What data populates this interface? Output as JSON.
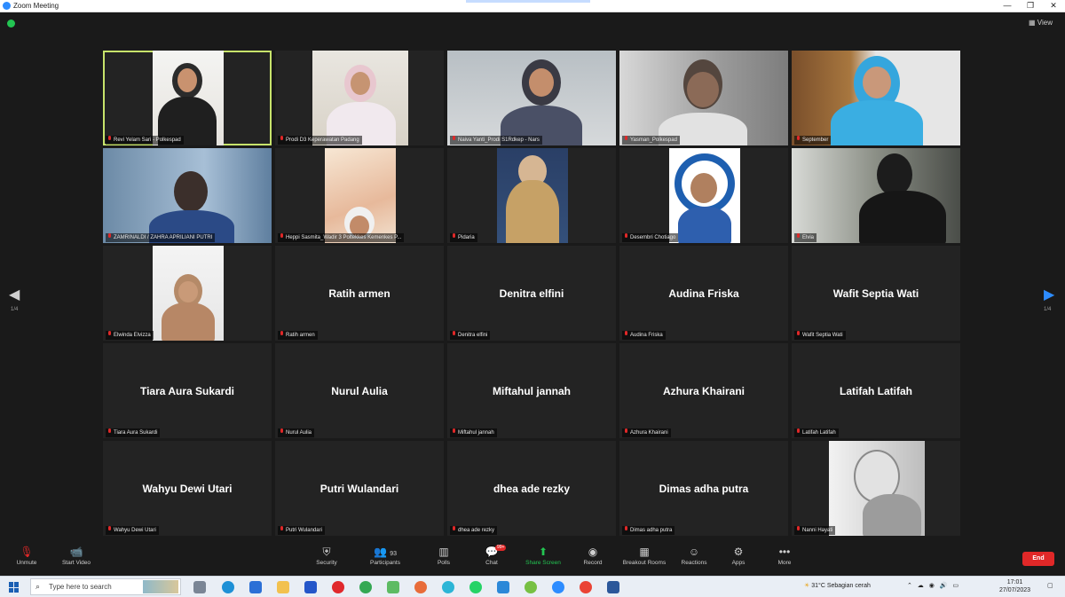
{
  "window": {
    "title": "Zoom Meeting",
    "controls": [
      "—",
      "❐",
      "✕"
    ]
  },
  "top": {
    "view_label": "View"
  },
  "pager": {
    "left": "1/4",
    "right": "1/4"
  },
  "tiles": [
    {
      "label": "Revi Yelam Sari - Polkespad",
      "name": "",
      "video": true
    },
    {
      "label": "Prodi D3 Keperawatan Padang",
      "name": "",
      "video": true
    },
    {
      "label": "Naiva Yanti_Prodi S1Rdkep - Nars",
      "name": "",
      "video": true
    },
    {
      "label": "Yasman_Polkespad",
      "name": "",
      "video": true
    },
    {
      "label": "September",
      "name": "",
      "video": true
    },
    {
      "label": "ZAMRINALDI / ZAHRA APRILIANI PUTRI",
      "name": "",
      "video": true
    },
    {
      "label": "Heppi Sasmita_Wadir 3 Poltekkes Kemenkes P...",
      "name": "",
      "video": true
    },
    {
      "label": "Pidaria",
      "name": "",
      "video": true
    },
    {
      "label": "Desembri Chotiago",
      "name": "",
      "video": true
    },
    {
      "label": "Elvia",
      "name": "",
      "video": true
    },
    {
      "label": "Elwinda Elvizza",
      "name": "",
      "video": true
    },
    {
      "label": "Ratih armen",
      "name": "Ratih armen",
      "video": false
    },
    {
      "label": "Denitra elfini",
      "name": "Denitra elfini",
      "video": false
    },
    {
      "label": "Audina Friska",
      "name": "Audina Friska",
      "video": false
    },
    {
      "label": "Wafit Septia Wati",
      "name": "Wafit Septia Wati",
      "video": false
    },
    {
      "label": "Tiara Aura Sukardi",
      "name": "Tiara Aura Sukardi",
      "video": false
    },
    {
      "label": "Nurul Aulia",
      "name": "Nurul Aulia",
      "video": false
    },
    {
      "label": "Miftahul jannah",
      "name": "Miftahul jannah",
      "video": false
    },
    {
      "label": "Azhura Khairani",
      "name": "Azhura Khairani",
      "video": false
    },
    {
      "label": "Latifah Latifah",
      "name": "Latifah Latifah",
      "video": false
    },
    {
      "label": "Wahyu Dewi Utari",
      "name": "Wahyu Dewi Utari",
      "video": false
    },
    {
      "label": "Putri Wulandari",
      "name": "Putri Wulandari",
      "video": false
    },
    {
      "label": "dhea ade rezky",
      "name": "dhea ade rezky",
      "video": false
    },
    {
      "label": "Dimas adha putra",
      "name": "Dimas adha putra",
      "video": false
    },
    {
      "label": "Nanni Hayati",
      "name": "",
      "video": true
    }
  ],
  "toolbar": {
    "unmute": "Unmute",
    "start_video": "Start Video",
    "security": "Security",
    "participants": "Participants",
    "participants_count": "93",
    "polls": "Polls",
    "chat": "Chat",
    "chat_badge": "99+",
    "share_screen": "Share Screen",
    "record": "Record",
    "breakout_rooms": "Breakout Rooms",
    "reactions": "Reactions",
    "apps": "Apps",
    "more": "More",
    "end": "End"
  },
  "taskbar": {
    "search_placeholder": "Type here to search",
    "weather": "31°C  Sebagian cerah",
    "time": "17:01",
    "date": "27/07/2023"
  },
  "colors": {
    "active_speaker": "#c7e36b",
    "end_button": "#e02828",
    "share_green": "#23c552",
    "zoom_blue": "#2d8cff"
  }
}
